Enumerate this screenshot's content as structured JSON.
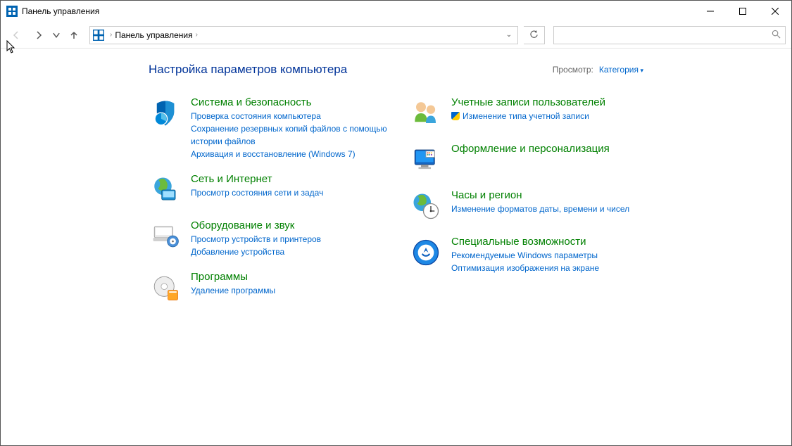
{
  "window": {
    "title": "Панель управления"
  },
  "address": {
    "location": "Панель управления"
  },
  "header": {
    "title": "Настройка параметров компьютера",
    "viewby_label": "Просмотр:",
    "viewby_value": "Категория"
  },
  "categories_left": [
    {
      "icon": "shield-icon",
      "title": "Система и безопасность",
      "links": [
        {
          "text": "Проверка состояния компьютера",
          "shield": false
        },
        {
          "text": "Сохранение резервных копий файлов с помощью истории файлов",
          "shield": false
        },
        {
          "text": "Архивация и восстановление (Windows 7)",
          "shield": false
        }
      ]
    },
    {
      "icon": "globe-icon",
      "title": "Сеть и Интернет",
      "links": [
        {
          "text": "Просмотр состояния сети и задач",
          "shield": false
        }
      ]
    },
    {
      "icon": "devices-icon",
      "title": "Оборудование и звук",
      "links": [
        {
          "text": "Просмотр устройств и принтеров",
          "shield": false
        },
        {
          "text": "Добавление устройства",
          "shield": false
        }
      ]
    },
    {
      "icon": "programs-icon",
      "title": "Программы",
      "links": [
        {
          "text": "Удаление программы",
          "shield": false
        }
      ]
    }
  ],
  "categories_right": [
    {
      "icon": "users-icon",
      "title": "Учетные записи пользователей",
      "links": [
        {
          "text": "Изменение типа учетной записи",
          "shield": true
        }
      ]
    },
    {
      "icon": "personalization-icon",
      "title": "Оформление и персонализация",
      "links": []
    },
    {
      "icon": "clock-region-icon",
      "title": "Часы и регион",
      "links": [
        {
          "text": "Изменение форматов даты, времени и чисел",
          "shield": false
        }
      ]
    },
    {
      "icon": "accessibility-icon",
      "title": "Специальные возможности",
      "links": [
        {
          "text": "Рекомендуемые Windows параметры",
          "shield": false
        },
        {
          "text": "Оптимизация изображения на экране",
          "shield": false
        }
      ]
    }
  ]
}
